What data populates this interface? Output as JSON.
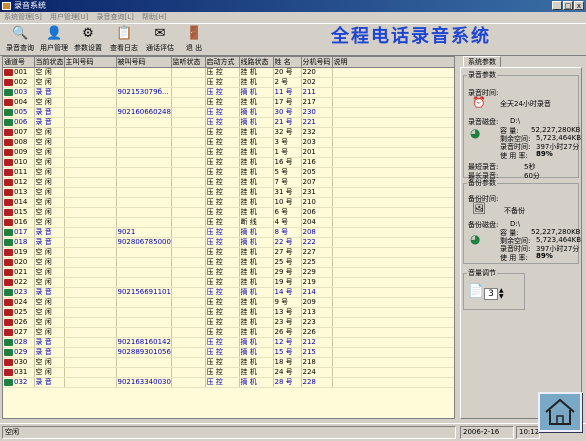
{
  "window": {
    "title": "录音系统"
  },
  "menu": [
    "系统管理[S]",
    "用户管理[U]",
    "录音查询[L]",
    "帮助[H]"
  ],
  "toolbar": [
    {
      "label": "录音查询",
      "icon": "search-records-icon",
      "glyph": "🔍"
    },
    {
      "label": "用户管理",
      "icon": "user-icon",
      "glyph": "👤"
    },
    {
      "label": "参数设置",
      "icon": "settings-icon",
      "glyph": "⚙"
    },
    {
      "label": "查看日志",
      "icon": "log-icon",
      "glyph": "📋"
    },
    {
      "label": "通话评估",
      "icon": "evaluate-icon",
      "glyph": "✉"
    },
    {
      "label": "退 出",
      "icon": "exit-icon",
      "glyph": "🚪"
    }
  ],
  "app_title": "全程电话录音系统",
  "table": {
    "headers": [
      "通道号",
      "当前状态",
      "主叫号码",
      "被叫号码",
      "监听状态",
      "启动方式",
      "线路状态",
      "姓 名",
      "分机号码",
      "说明"
    ],
    "rows": [
      [
        "001",
        "空 闲",
        "",
        "",
        "",
        "压 控",
        "挂 机",
        "20 号",
        "220",
        ""
      ],
      [
        "002",
        "空 闲",
        "",
        "",
        "",
        "压 控",
        "挂 机",
        "2 号",
        "202",
        ""
      ],
      [
        "003",
        "录 音",
        "",
        "902153079б...",
        "",
        "压 控",
        "摘 机",
        "11 号",
        "211",
        ""
      ],
      [
        "004",
        "空 闲",
        "",
        "",
        "",
        "压 控",
        "挂 机",
        "17 号",
        "217",
        ""
      ],
      [
        "005",
        "录 音",
        "",
        "902160660248#",
        "",
        "压 控",
        "摘 机",
        "30 号",
        "230",
        ""
      ],
      [
        "006",
        "录 音",
        "",
        "",
        "",
        "压 控",
        "摘 机",
        "21 号",
        "221",
        ""
      ],
      [
        "007",
        "空 闲",
        "",
        "",
        "",
        "压 控",
        "挂 机",
        "32 号",
        "232",
        ""
      ],
      [
        "008",
        "空 闲",
        "",
        "",
        "",
        "压 控",
        "挂 机",
        "3 号",
        "203",
        ""
      ],
      [
        "009",
        "空 闲",
        "",
        "",
        "",
        "压 控",
        "挂 机",
        "1 号",
        "201",
        ""
      ],
      [
        "010",
        "空 闲",
        "",
        "",
        "",
        "压 控",
        "挂 机",
        "16 号",
        "216",
        ""
      ],
      [
        "011",
        "空 闲",
        "",
        "",
        "",
        "压 控",
        "挂 机",
        "5 号",
        "205",
        ""
      ],
      [
        "012",
        "空 闲",
        "",
        "",
        "",
        "压 控",
        "挂 机",
        "7 号",
        "207",
        ""
      ],
      [
        "013",
        "空 闲",
        "",
        "",
        "",
        "压 控",
        "挂 机",
        "31 号",
        "231",
        ""
      ],
      [
        "014",
        "空 闲",
        "",
        "",
        "",
        "压 控",
        "挂 机",
        "10 号",
        "210",
        ""
      ],
      [
        "015",
        "空 闲",
        "",
        "",
        "",
        "压 控",
        "挂 机",
        "6 号",
        "206",
        ""
      ],
      [
        "016",
        "空 闲",
        "",
        "",
        "",
        "压 控",
        "断 线",
        "4 号",
        "204",
        ""
      ],
      [
        "017",
        "录 音",
        "",
        "9021",
        "",
        "压 控",
        "摘 机",
        "8 号",
        "208",
        ""
      ],
      [
        "018",
        "录 音",
        "",
        "902806785000",
        "",
        "压 控",
        "摘 机",
        "22 号",
        "222",
        ""
      ],
      [
        "019",
        "空 闲",
        "",
        "",
        "",
        "压 控",
        "挂 机",
        "27 号",
        "227",
        ""
      ],
      [
        "020",
        "空 闲",
        "",
        "",
        "",
        "压 控",
        "挂 机",
        "25 号",
        "225",
        ""
      ],
      [
        "021",
        "空 闲",
        "",
        "",
        "",
        "压 控",
        "挂 机",
        "29 号",
        "229",
        ""
      ],
      [
        "022",
        "空 闲",
        "",
        "",
        "",
        "压 控",
        "挂 机",
        "19 号",
        "219",
        ""
      ],
      [
        "023",
        "录 音",
        "",
        "902156691101#",
        "",
        "压 控",
        "摘 机",
        "14 号",
        "214",
        ""
      ],
      [
        "024",
        "空 闲",
        "",
        "",
        "",
        "压 控",
        "挂 机",
        "9 号",
        "209",
        ""
      ],
      [
        "025",
        "空 闲",
        "",
        "",
        "",
        "压 控",
        "挂 机",
        "13 号",
        "213",
        ""
      ],
      [
        "026",
        "空 闲",
        "",
        "",
        "",
        "压 控",
        "挂 机",
        "23 号",
        "223",
        ""
      ],
      [
        "027",
        "空 闲",
        "",
        "",
        "",
        "压 控",
        "挂 机",
        "26 号",
        "226",
        ""
      ],
      [
        "028",
        "录 音",
        "",
        "902168160142#",
        "",
        "压 控",
        "摘 机",
        "12 号",
        "212",
        ""
      ],
      [
        "029",
        "录 音",
        "",
        "902889301056#",
        "",
        "压 控",
        "摘 机",
        "15 号",
        "215",
        ""
      ],
      [
        "030",
        "空 闲",
        "",
        "",
        "",
        "压 控",
        "挂 机",
        "18 号",
        "218",
        ""
      ],
      [
        "031",
        "空 闲",
        "",
        "",
        "",
        "压 控",
        "挂 机",
        "24 号",
        "224",
        ""
      ],
      [
        "032",
        "录 音",
        "",
        "902163340030",
        "",
        "压 控",
        "摘 机",
        "28 号",
        "228",
        ""
      ]
    ]
  },
  "panel": {
    "tab": "系统参数",
    "rec_params": {
      "legend": "录音参数",
      "time_label": "录音时间:",
      "time_value": "全天24小时录音",
      "disk_label": "录音磁盘:",
      "disk_value": "D:\\",
      "cap_label": "容    量:",
      "cap_value": "52,227,280KB",
      "free_label": "剩余空间:",
      "free_value": "5,723,464KB",
      "rectime_label": "录音时间:",
      "rectime_value": "397小时27分",
      "usage_label": "使 用 率:",
      "usage_value": "89%",
      "min_label": "最短录音:",
      "min_value": "5秒",
      "max_label": "最长录音:",
      "max_value": "60分"
    },
    "backup": {
      "legend": "备份参数",
      "time_label": "备份时间:",
      "time_value": "不备份",
      "disk_label": "备份磁盘:",
      "disk_value": "D:\\",
      "cap_label": "容    量:",
      "cap_value": "52,227,280KB",
      "free_label": "剩余空间:",
      "free_value": "5,723,464KB",
      "rectime_label": "录音时间:",
      "rectime_value": "397小时27分",
      "usage_label": "使 用 率:",
      "usage_value": "89%"
    },
    "volume": {
      "legend": "音量调节",
      "value": "3"
    }
  },
  "status": {
    "left": "空闲",
    "date": "2006-2-16",
    "time": "10:12"
  }
}
